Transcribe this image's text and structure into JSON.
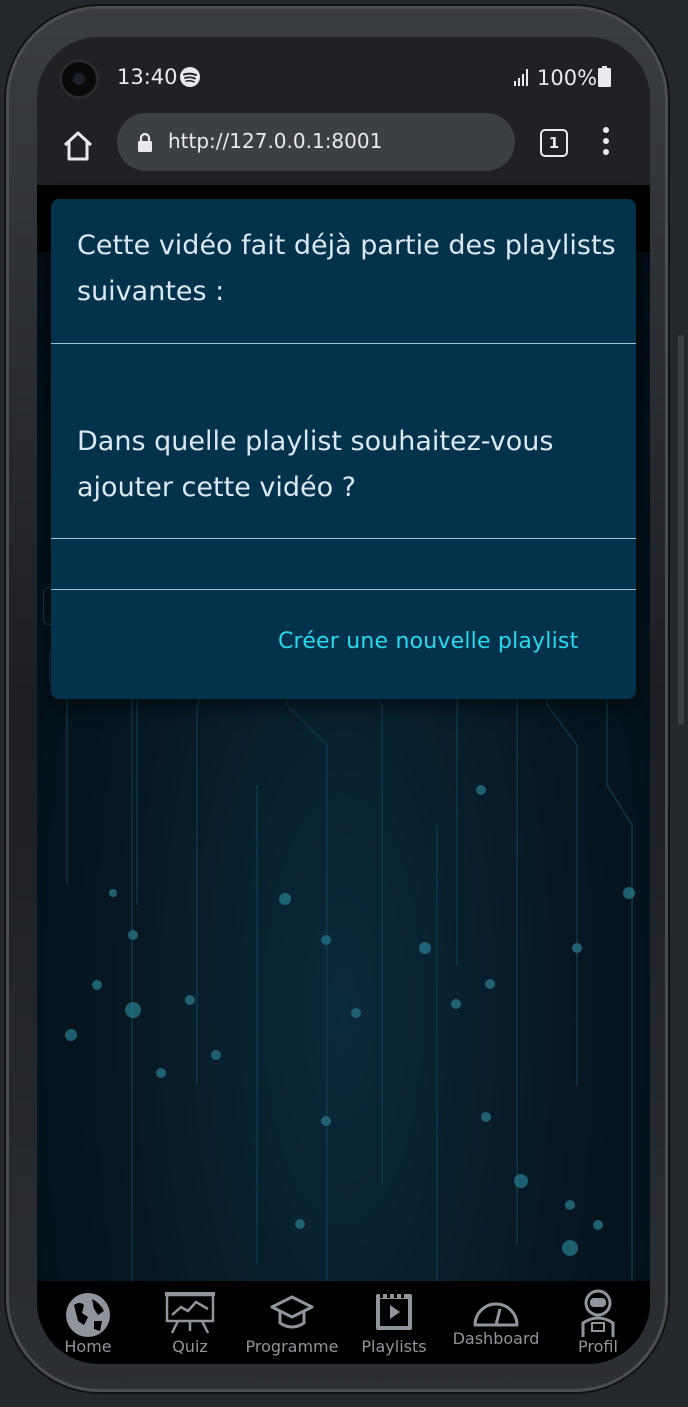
{
  "status_bar": {
    "time": "13:40",
    "battery": "100%"
  },
  "browser": {
    "url": "http://127.0.0.1:8001",
    "tab_count": "1"
  },
  "dialog": {
    "existing_playlists_heading": "Cette vidéo fait déjà partie des playlists suivantes :",
    "choose_playlist_heading": "Dans quelle playlist souhaitez-vous ajouter cette vidéo ?",
    "create_playlist_link": "Créer une nouvelle playlist"
  },
  "bottom_nav": {
    "items": [
      {
        "label": "Home",
        "icon": "globe-icon"
      },
      {
        "label": "Quiz",
        "icon": "chart-board-icon"
      },
      {
        "label": "Programme",
        "icon": "graduation-cap-icon"
      },
      {
        "label": "Playlists",
        "icon": "video-playlist-icon"
      },
      {
        "label": "Dashboard",
        "icon": "gauge-icon"
      },
      {
        "label": "Profil",
        "icon": "astronaut-icon"
      }
    ]
  },
  "colors": {
    "dialog_bg": "#03324d",
    "link": "#29d9ef",
    "nav_label": "#8f959a"
  }
}
